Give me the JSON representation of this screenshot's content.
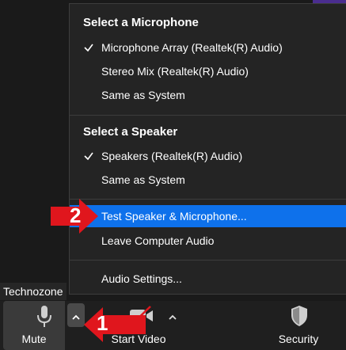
{
  "participant": {
    "name": "Technozone"
  },
  "menu": {
    "microphone_header": "Select a Microphone",
    "microphones": [
      {
        "label": "Microphone Array (Realtek(R) Audio)",
        "checked": true
      },
      {
        "label": "Stereo Mix (Realtek(R) Audio)",
        "checked": false
      },
      {
        "label": "Same as System",
        "checked": false
      }
    ],
    "speaker_header": "Select a Speaker",
    "speakers": [
      {
        "label": "Speakers (Realtek(R) Audio)",
        "checked": true
      },
      {
        "label": "Same as System",
        "checked": false
      }
    ],
    "test_label": "Test Speaker & Microphone...",
    "leave_label": "Leave Computer Audio",
    "settings_label": "Audio Settings..."
  },
  "toolbar": {
    "mute_label": "Mute",
    "video_label": "Start Video",
    "security_label": "Security"
  },
  "annotations": {
    "step1": "1",
    "step2": "2"
  },
  "colors": {
    "highlight": "#0e71eb",
    "arrow_red": "#e0161d",
    "menu_bg": "#242424"
  },
  "icons": {
    "mic": "microphone-icon",
    "video_off": "video-off-icon",
    "security": "shield-icon",
    "caret": "caret-up-icon",
    "check": "checkmark-icon"
  }
}
